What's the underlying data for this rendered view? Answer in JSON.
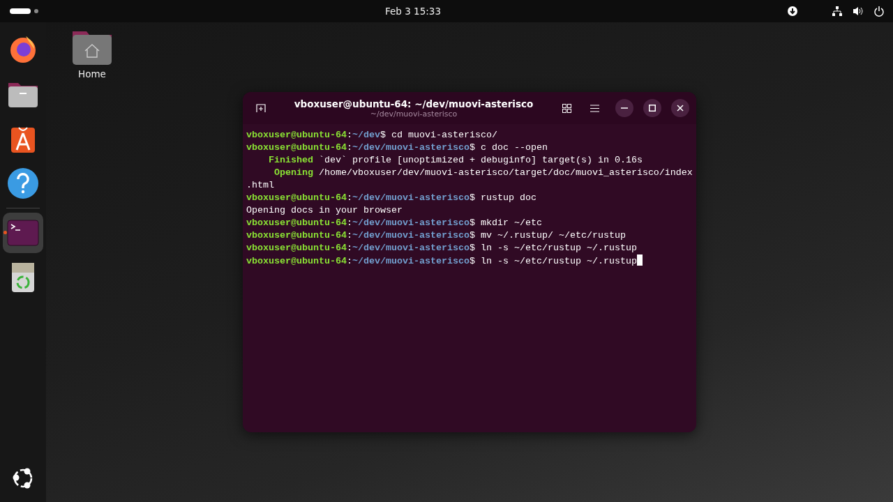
{
  "top_bar": {
    "clock": "Feb 3  15:33"
  },
  "dock": [
    {
      "kind": "firefox",
      "selected": false,
      "running": false
    },
    {
      "kind": "files",
      "selected": false,
      "running": false
    },
    {
      "kind": "store",
      "selected": false,
      "running": false
    },
    {
      "kind": "help",
      "selected": false,
      "running": false
    },
    {
      "kind": "terminal",
      "selected": true,
      "running": true
    },
    {
      "kind": "trash",
      "selected": false,
      "running": false
    }
  ],
  "desktop_icons": [
    {
      "label": "Home"
    }
  ],
  "window": {
    "title": "vboxuser@ubuntu-64: ~/dev/muovi-asterisco",
    "subtitle": "~/dev/muovi-asterisco",
    "lines": [
      {
        "kind": "prompt",
        "user": "vboxuser@ubuntu-64",
        "sep": ":",
        "path": "~/dev",
        "symbol": "$",
        "command": "cd muovi-asterisco/"
      },
      {
        "kind": "prompt",
        "user": "vboxuser@ubuntu-64",
        "sep": ":",
        "path": "~/dev/muovi-asterisco",
        "symbol": "$",
        "command": "c doc --open"
      },
      {
        "kind": "status",
        "label": "Finished",
        "text": "`dev` profile [unoptimized + debuginfo] target(s) in 0.16s"
      },
      {
        "kind": "status",
        "label": "Opening",
        "text": "/home/vboxuser/dev/muovi-asterisco/target/doc/muovi_asterisco/index"
      },
      {
        "kind": "output",
        "text": ".html"
      },
      {
        "kind": "prompt",
        "user": "vboxuser@ubuntu-64",
        "sep": ":",
        "path": "~/dev/muovi-asterisco",
        "symbol": "$",
        "command": "rustup doc"
      },
      {
        "kind": "output",
        "text": "Opening docs in your browser"
      },
      {
        "kind": "prompt",
        "user": "vboxuser@ubuntu-64",
        "sep": ":",
        "path": "~/dev/muovi-asterisco",
        "symbol": "$",
        "command": "mkdir ~/etc"
      },
      {
        "kind": "prompt",
        "user": "vboxuser@ubuntu-64",
        "sep": ":",
        "path": "~/dev/muovi-asterisco",
        "symbol": "$",
        "command": "mv ~/.rustup/ ~/etc/rustup"
      },
      {
        "kind": "prompt",
        "user": "vboxuser@ubuntu-64",
        "sep": ":",
        "path": "~/dev/muovi-asterisco",
        "symbol": "$",
        "command": "ln -s ~/etc/rustup ~/.rustup"
      },
      {
        "kind": "prompt",
        "user": "vboxuser@ubuntu-64",
        "sep": ":",
        "path": "~/dev/muovi-asterisco",
        "symbol": "$",
        "command": "ln -s ~/etc/rustup ~/.rustup",
        "cursor": true
      }
    ]
  }
}
